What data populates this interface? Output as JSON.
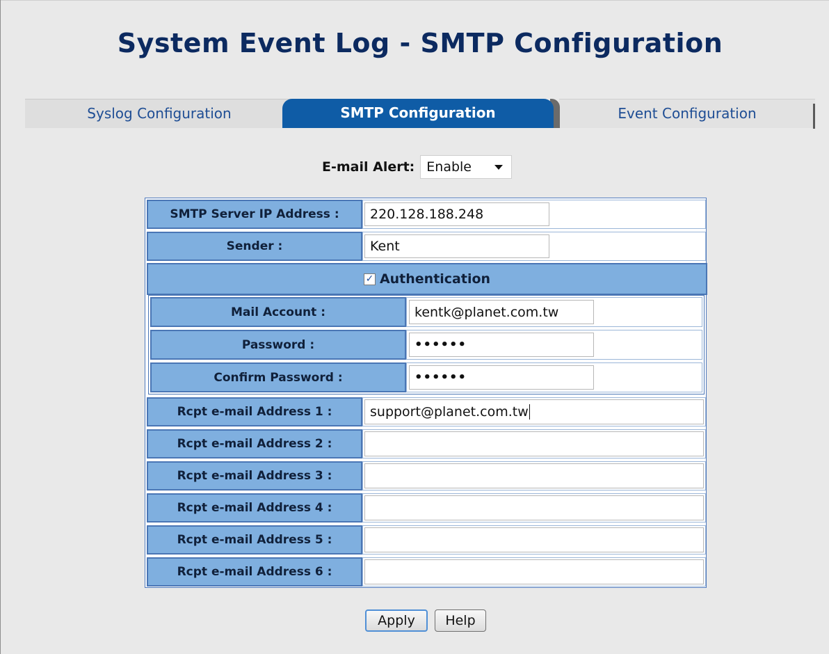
{
  "title": "System Event Log - SMTP Configuration",
  "tabs": {
    "syslog": "Syslog Configuration",
    "smtp": "SMTP Configuration",
    "event": "Event Configuration",
    "active": "SMTP Configuration"
  },
  "email_alert": {
    "label": "E-mail Alert:",
    "value": "Enable"
  },
  "smtp": {
    "server_ip_label": "SMTP Server IP Address :",
    "server_ip_value": "220.128.188.248",
    "sender_label": "Sender :",
    "sender_value": "Kent",
    "auth_label": "Authentication",
    "auth_checked": true,
    "mail_account_label": "Mail Account :",
    "mail_account_value": "kentk@planet.com.tw",
    "password_label": "Password :",
    "password_value": "••••••",
    "confirm_password_label": "Confirm Password :",
    "confirm_password_value": "••••••"
  },
  "recipients": [
    {
      "label": "Rcpt e-mail Address 1 :",
      "value": "support@planet.com.tw"
    },
    {
      "label": "Rcpt e-mail Address 2 :",
      "value": ""
    },
    {
      "label": "Rcpt e-mail Address 3 :",
      "value": ""
    },
    {
      "label": "Rcpt e-mail Address 4 :",
      "value": ""
    },
    {
      "label": "Rcpt e-mail Address 5 :",
      "value": ""
    },
    {
      "label": "Rcpt e-mail Address 6 :",
      "value": ""
    }
  ],
  "buttons": {
    "apply": "Apply",
    "help": "Help"
  },
  "colors": {
    "title": "#0c2a60",
    "active_tab": "#0f5ca6",
    "label_cell": "#7fafdf",
    "border": "#4a76b5",
    "background": "#e9e9e9"
  }
}
